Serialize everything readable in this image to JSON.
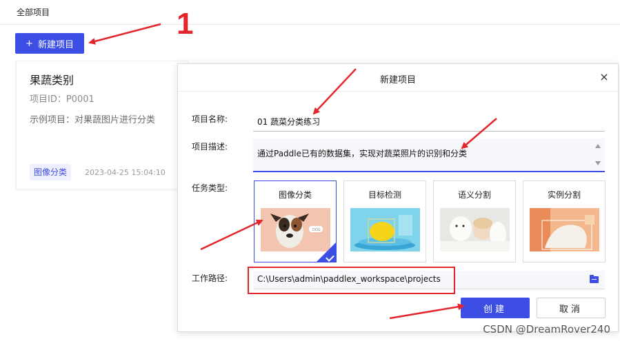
{
  "topbar": {
    "title": "全部项目"
  },
  "toolbar": {
    "new_project_label": "新建项目",
    "plus": "+"
  },
  "project_card": {
    "name": "果蔬类别",
    "id_text": "项目ID：P0001",
    "description": "示例项目：对果蔬图片进行分类",
    "tag": "图像分类",
    "date": "2023-04-25 15:04:10"
  },
  "modal": {
    "title": "新建项目",
    "name_label": "项目名称:",
    "name_value": "01 蔬菜分类练习",
    "desc_label": "项目描述:",
    "desc_value": "通过Paddle已有的数据集，实现对蔬菜照片的识别和分类",
    "task_label": "任务类型:",
    "tasks": [
      {
        "label": "图像分类",
        "selected": true,
        "image_icon": "dog-photo"
      },
      {
        "label": "目标检测",
        "selected": false,
        "image_icon": "lemon-photo"
      },
      {
        "label": "语义分割",
        "selected": false,
        "image_icon": "dog-child-photo"
      },
      {
        "label": "实例分割",
        "selected": false,
        "image_icon": "person-photo"
      }
    ],
    "path_label": "工作路径:",
    "path_value": "C:\\Users\\admin\\paddlex_workspace\\projects",
    "create_label": "创建",
    "cancel_label": "取消",
    "close_symbol": "×"
  },
  "annotation": {
    "number": "1"
  },
  "watermark": "CSDN @DreamRover240",
  "colors": {
    "primary": "#3d4ee5",
    "annotation_red": "#e3262c"
  }
}
